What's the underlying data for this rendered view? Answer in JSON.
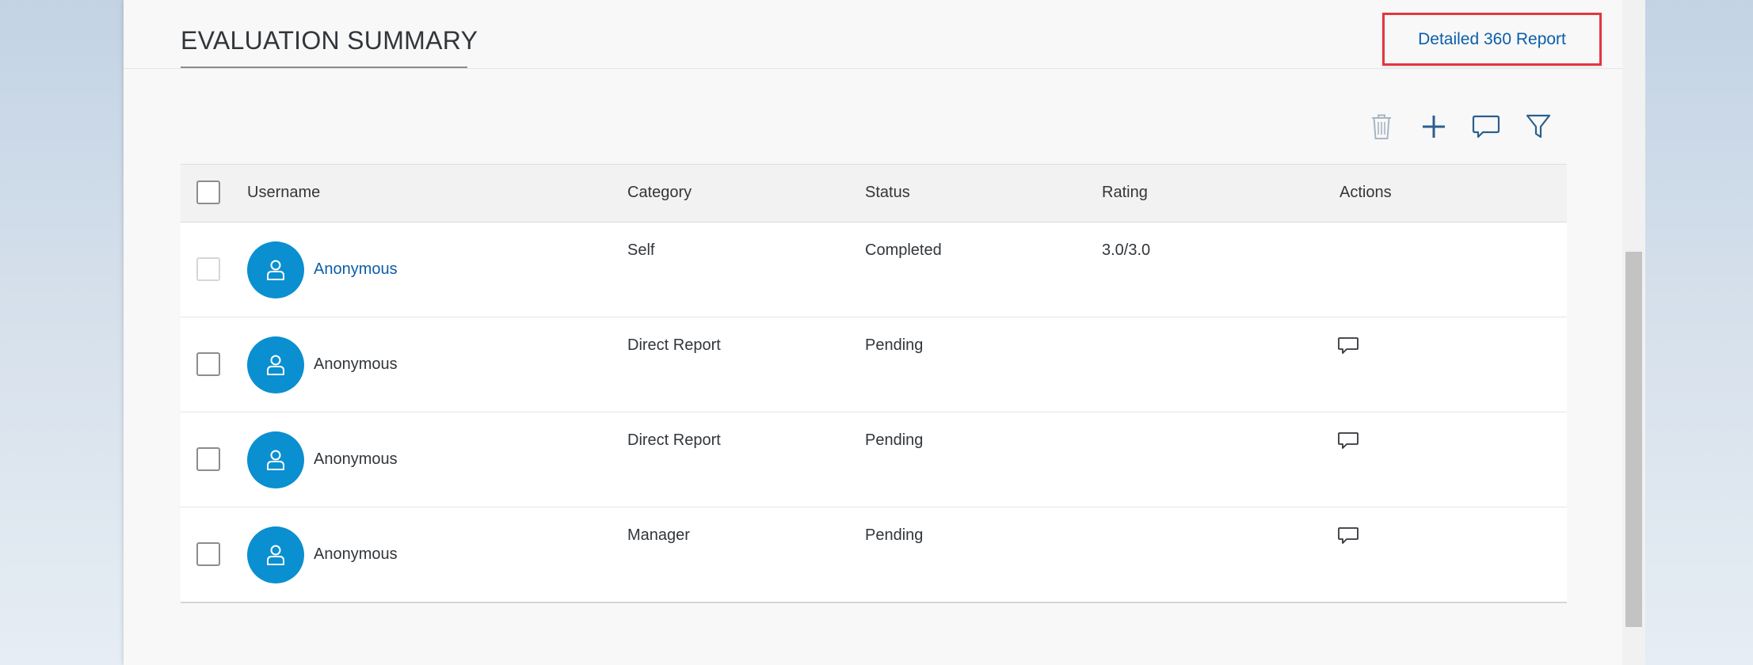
{
  "section": {
    "title": "EVALUATION SUMMARY"
  },
  "header": {
    "report_link": "Detailed 360 Report"
  },
  "toolbar": {
    "delete_icon": "trash-icon",
    "add_icon": "plus-icon",
    "comment_icon": "comment-icon",
    "filter_icon": "filter-icon"
  },
  "table": {
    "columns": [
      "Username",
      "Category",
      "Status",
      "Rating",
      "Actions"
    ],
    "rows": [
      {
        "username": "Anonymous",
        "category": "Self",
        "status": "Completed",
        "rating": "3.0/3.0",
        "has_action": false,
        "link": true,
        "checkbox_disabled": true
      },
      {
        "username": "Anonymous",
        "category": "Direct Report",
        "status": "Pending",
        "rating": "",
        "has_action": true,
        "link": false,
        "checkbox_disabled": false
      },
      {
        "username": "Anonymous",
        "category": "Direct Report",
        "status": "Pending",
        "rating": "",
        "has_action": true,
        "link": false,
        "checkbox_disabled": false
      },
      {
        "username": "Anonymous",
        "category": "Manager",
        "status": "Pending",
        "rating": "",
        "has_action": true,
        "link": false,
        "checkbox_disabled": false
      }
    ]
  },
  "colors": {
    "accent_link": "#0b5ea9",
    "avatar_bg": "#0a8fd1",
    "highlight_box": "#e2373f",
    "icon_blue": "#2b5f8f"
  }
}
